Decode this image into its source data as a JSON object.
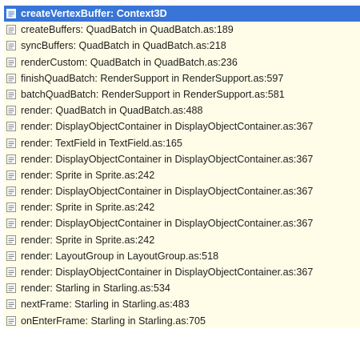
{
  "call_stack": {
    "selected_index": 0,
    "row_icon": "stack-frame-icon",
    "colors": {
      "list_background": "#fffde7",
      "selection_background": "#3875d7",
      "text": "#1e1e1e",
      "selected_text": "#ffffff"
    },
    "frames": [
      {
        "label": "createVertexBuffer: Context3D"
      },
      {
        "label": "createBuffers: QuadBatch in QuadBatch.as:189"
      },
      {
        "label": "syncBuffers: QuadBatch in QuadBatch.as:218"
      },
      {
        "label": "renderCustom: QuadBatch in QuadBatch.as:236"
      },
      {
        "label": "finishQuadBatch: RenderSupport in RenderSupport.as:597"
      },
      {
        "label": "batchQuadBatch: RenderSupport in RenderSupport.as:581"
      },
      {
        "label": "render: QuadBatch in QuadBatch.as:488"
      },
      {
        "label": "render: DisplayObjectContainer in DisplayObjectContainer.as:367"
      },
      {
        "label": "render: TextField in TextField.as:165"
      },
      {
        "label": "render: DisplayObjectContainer in DisplayObjectContainer.as:367"
      },
      {
        "label": "render: Sprite in Sprite.as:242"
      },
      {
        "label": "render: DisplayObjectContainer in DisplayObjectContainer.as:367"
      },
      {
        "label": "render: Sprite in Sprite.as:242"
      },
      {
        "label": "render: DisplayObjectContainer in DisplayObjectContainer.as:367"
      },
      {
        "label": "render: Sprite in Sprite.as:242"
      },
      {
        "label": "render: LayoutGroup in LayoutGroup.as:518"
      },
      {
        "label": "render: DisplayObjectContainer in DisplayObjectContainer.as:367"
      },
      {
        "label": "render: Starling in Starling.as:534"
      },
      {
        "label": "nextFrame: Starling in Starling.as:483"
      },
      {
        "label": "onEnterFrame: Starling in Starling.as:705"
      }
    ]
  }
}
